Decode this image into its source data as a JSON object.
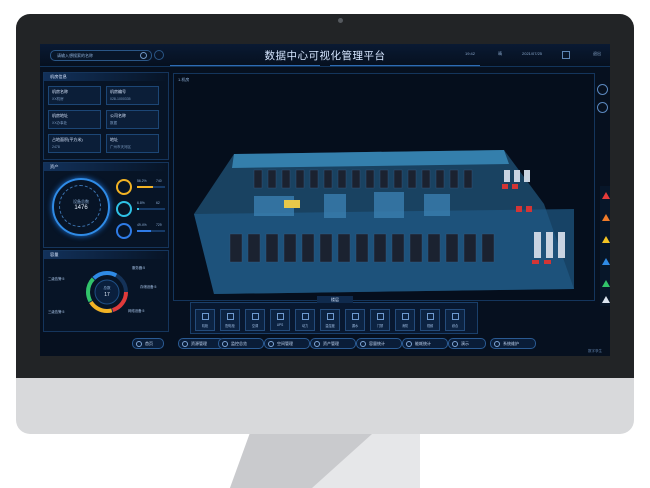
{
  "app": {
    "title": "数据中心可视化管理平台",
    "search_placeholder": "请输入想搜索的名称",
    "top_right": [
      "19:42",
      "晴",
      "2021/07/25"
    ],
    "logout": "退出"
  },
  "left": {
    "machine_room_title": "机房信息",
    "machine_room_info": [
      {
        "label": "机房名称",
        "value": "XX机房"
      },
      {
        "label": "机房编号",
        "value": "028-1000335"
      },
      {
        "label": "机房地址",
        "value": "XX办事处"
      },
      {
        "label": "公司名称",
        "value": "数据"
      },
      {
        "label": "占地面积(平方米)",
        "value": "2478"
      },
      {
        "label": "地址",
        "value": "广州市天河区"
      }
    ],
    "asset_title": "资产",
    "asset_total_label": "设备总数",
    "asset_total": "1476",
    "asset_rows": [
      {
        "pct": "56.2%",
        "count": "740",
        "color": "#f2b324",
        "fill": 0.56
      },
      {
        "pct": "6.8%",
        "count": "62",
        "color": "#2fc2e6",
        "fill": 0.07
      },
      {
        "pct": "49.4%",
        "count": "729",
        "color": "#2f7be6",
        "fill": 0.49
      }
    ],
    "capacity_title": "容量",
    "capacity_center_label": "总数",
    "capacity_center_value": "17",
    "capacity_segments": [
      "服务器:5",
      "存储设备:5",
      "网络设备:5",
      "二级告警:5",
      "三级告警:5"
    ]
  },
  "view": {
    "label": "1.机房"
  },
  "dock": {
    "tab_label": "楼层",
    "tools": [
      "机柜",
      "配电柜",
      "空调",
      "UPS",
      "动力",
      "温湿度",
      "漏水",
      "门禁",
      "消防",
      "视频",
      "综合"
    ]
  },
  "nav": {
    "items": [
      "首页",
      "资源管理",
      "监控总览",
      "空间管理",
      "资产管理",
      "容量统计",
      "能耗统计",
      "演示",
      "系统维护"
    ]
  },
  "status": {
    "footer": "数字孪生"
  }
}
